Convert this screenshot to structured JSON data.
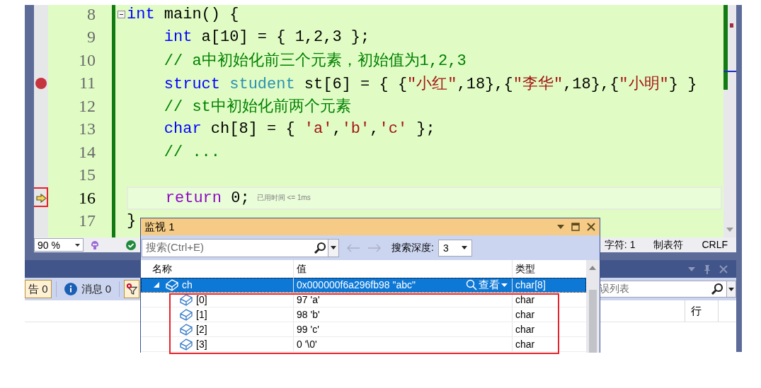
{
  "editor": {
    "lines": [
      {
        "number": "8",
        "fold": true,
        "breakpoint": false,
        "current": false,
        "tokens": [
          {
            "kind": "keyword",
            "text": "int"
          },
          {
            "kind": "plain",
            "text": " main() {"
          }
        ]
      },
      {
        "number": "9",
        "fold": false,
        "breakpoint": false,
        "current": false,
        "tokens": [
          {
            "kind": "keyword",
            "text": "    int"
          },
          {
            "kind": "plain",
            "text": " a[10] = { 1,2,3 };"
          }
        ]
      },
      {
        "number": "10",
        "fold": false,
        "breakpoint": false,
        "current": false,
        "tokens": [
          {
            "kind": "comment",
            "text": "    // a中初始化前三个元素，初始值为1,2,3"
          }
        ]
      },
      {
        "number": "11",
        "fold": false,
        "breakpoint": true,
        "current": false,
        "tokens": [
          {
            "kind": "keyword",
            "text": "    struct"
          },
          {
            "kind": "type",
            "text": " student"
          },
          {
            "kind": "plain",
            "text": " st[6] = { {"
          },
          {
            "kind": "string",
            "text": "\"小红\""
          },
          {
            "kind": "plain",
            "text": ",18},{"
          },
          {
            "kind": "string",
            "text": "\"李华\""
          },
          {
            "kind": "plain",
            "text": ",18},{"
          },
          {
            "kind": "string",
            "text": "\"小明\""
          },
          {
            "kind": "plain",
            "text": "} }"
          }
        ]
      },
      {
        "number": "12",
        "fold": false,
        "breakpoint": false,
        "current": false,
        "tokens": [
          {
            "kind": "comment",
            "text": "    // st中初始化前两个元素"
          }
        ]
      },
      {
        "number": "13",
        "fold": false,
        "breakpoint": false,
        "current": false,
        "tokens": [
          {
            "kind": "keyword",
            "text": "    char"
          },
          {
            "kind": "plain",
            "text": " ch[8] = { "
          },
          {
            "kind": "string",
            "text": "'a'"
          },
          {
            "kind": "plain",
            "text": ","
          },
          {
            "kind": "string",
            "text": "'b'"
          },
          {
            "kind": "plain",
            "text": ","
          },
          {
            "kind": "string",
            "text": "'c'"
          },
          {
            "kind": "plain",
            "text": " };"
          }
        ]
      },
      {
        "number": "14",
        "fold": false,
        "breakpoint": false,
        "current": false,
        "tokens": [
          {
            "kind": "comment",
            "text": "    // ..."
          }
        ]
      },
      {
        "number": "15",
        "fold": false,
        "breakpoint": false,
        "current": false
      },
      {
        "number": "16",
        "fold": false,
        "breakpoint": false,
        "current": true,
        "annotated": true,
        "tokens": [
          {
            "kind": "control",
            "text": "    return"
          },
          {
            "kind": "plain",
            "text": " 0;"
          }
        ]
      },
      {
        "number": "17",
        "fold": false,
        "breakpoint": false,
        "current": false,
        "tokens": [
          {
            "kind": "plain",
            "text": "}"
          }
        ]
      }
    ],
    "inline_hint": "已用时间 <= 1ms"
  },
  "status_bar": {
    "zoom": "90 %",
    "items": [
      "字符: 1",
      "制表符",
      "CRLF"
    ]
  },
  "error_list": {
    "buttons": [
      {
        "kind": "warning",
        "label": "告 0",
        "selected": true
      },
      {
        "kind": "info",
        "label": "消息 0",
        "selected": false
      },
      {
        "kind": "filter",
        "selected": true
      }
    ],
    "search_placeholder": "误列表",
    "columns": [
      "行"
    ]
  },
  "watch": {
    "title": "监视 1",
    "search_placeholder": "搜索(Ctrl+E)",
    "depth_label": "搜索深度:",
    "depth": "3",
    "columns": [
      "名称",
      "值",
      "类型"
    ],
    "rows": [
      {
        "name": "ch",
        "value": "0x000000f6a296fb98 \"abc\"",
        "viewer": "查看",
        "type": "char[8]",
        "selected": true,
        "expanded": true,
        "children_annotated": true,
        "children": [
          {
            "name": "[0]",
            "value": "97 'a'",
            "type": "char"
          },
          {
            "name": "[1]",
            "value": "98 'b'",
            "type": "char"
          },
          {
            "name": "[2]",
            "value": "99 'c'",
            "type": "char"
          },
          {
            "name": "[3]",
            "value": "0 '\\0'",
            "type": "char"
          }
        ]
      }
    ]
  }
}
